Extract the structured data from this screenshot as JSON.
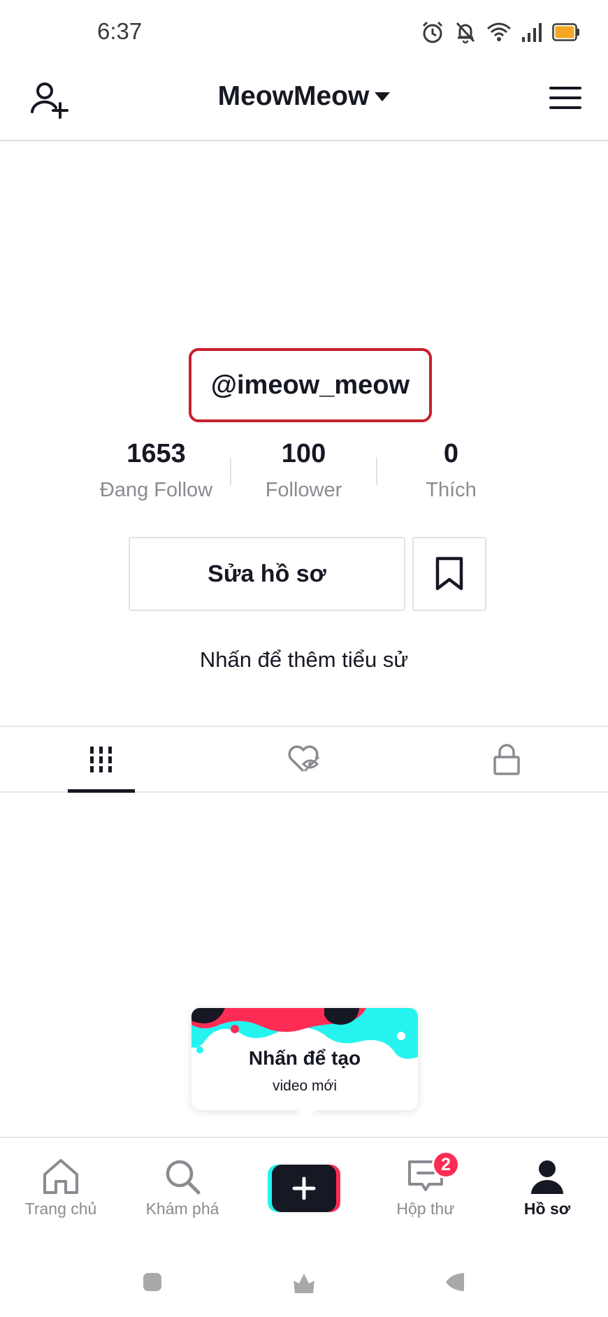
{
  "status_bar": {
    "time": "6:37",
    "icons": [
      "alarm-icon",
      "bell-off-icon",
      "wifi-icon",
      "signal-icon",
      "battery-icon"
    ],
    "battery_color": "#f5a623"
  },
  "header": {
    "account_name": "MeowMeow",
    "add_user_icon": "add-user-icon",
    "menu_icon": "hamburger-menu-icon"
  },
  "profile": {
    "username": "@imeow_meow",
    "highlight_color": "#c8202c",
    "stats": [
      {
        "value": "1653",
        "label": "Đang Follow"
      },
      {
        "value": "100",
        "label": "Follower"
      },
      {
        "value": "0",
        "label": "Thích"
      }
    ],
    "edit_button": "Sửa hồ sơ",
    "bookmark_icon": "bookmark-icon",
    "bio_prompt": "Nhấn để thêm tiểu sử"
  },
  "tabs": [
    {
      "icon": "videos-grid-icon",
      "active": true
    },
    {
      "icon": "liked-hidden-icon",
      "active": false
    },
    {
      "icon": "lock-icon",
      "active": false
    }
  ],
  "create_tip": {
    "title": "Nhấn để tạo",
    "subtitle": "video mới"
  },
  "bottom_nav": {
    "items": [
      {
        "label": "Trang chủ",
        "icon": "home-icon"
      },
      {
        "label": "Khám phá",
        "icon": "search-icon"
      },
      {
        "label": "",
        "icon": "create-plus-icon"
      },
      {
        "label": "Hộp thư",
        "icon": "inbox-icon",
        "badge": "2"
      },
      {
        "label": "Hồ sơ",
        "icon": "profile-icon",
        "active": true
      }
    ]
  },
  "colors": {
    "text": "#161823",
    "muted": "#8a8b91",
    "accent_pink": "#fe2c55",
    "accent_cyan": "#25f4ee"
  }
}
